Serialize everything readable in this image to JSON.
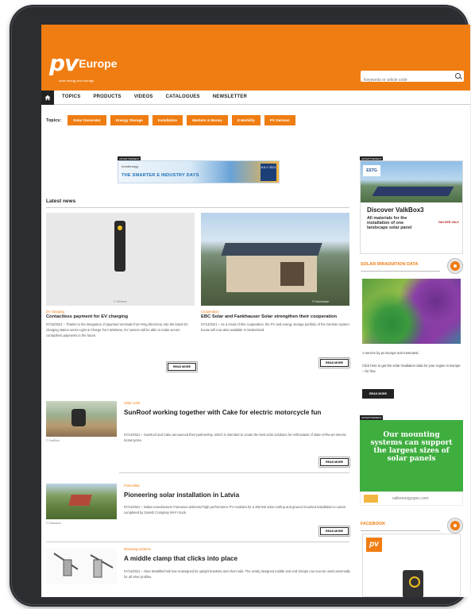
{
  "header": {
    "logo_main": "pv",
    "logo_sub": "Europe",
    "logo_tagline": "solar energy and storage",
    "search_placeholder": "Keywords or article code"
  },
  "nav": {
    "items": [
      "TOPICS",
      "PRODUCTS",
      "VIDEOS",
      "CATALOGUES",
      "NEWSLETTER"
    ]
  },
  "topics": {
    "label": "Topics:",
    "items": [
      "Solar Generator",
      "Energy Storage",
      "Installation",
      "Markets & Money",
      "E-Mobility",
      "PV German"
    ]
  },
  "banner": {
    "badge": "ADVERTISEMENT",
    "brand": "trendenergy",
    "text": "THE SMARTER E INDUSTRY DAYS",
    "date": "JULY 2021"
  },
  "latest_news": {
    "title": "Latest news",
    "cards": [
      {
        "category": "EV charging",
        "title": "Contactless payment for EV charging",
        "text": "07/15/2021 – Thanks to the integration of payment terminals from Feig Electronic into the latest EV charging station series Light & Charge from Wirelane, EV owners will be able to make secure contactless payments in the future.",
        "image_caption": "© Wirelane",
        "read_more": "READ MORE"
      },
      {
        "category": "Cooperation",
        "title": "EBC Solar and Fankhauser Solar strengthen their cooperation",
        "text": "07/14/2021 – As a result of this cooperation, the PV and energy storage portfolio of the German system house will now also available in Switzerland.",
        "image_caption": "© Fankhauser",
        "read_more": "READ MORE"
      }
    ],
    "list": [
      {
        "category": "Solar roofs",
        "title": "SunRoof working together with Cake for electric motorcycle fun",
        "text": "07/14/2021 – SunRoof and Cake announced their partnership, which is intended to create the best solar solutions for enthusiasts of state-of-the-art electric motorcycles.",
        "image_caption": "© SunRoof",
        "read_more": "READ MORE"
      },
      {
        "category": "Fotovoltaic",
        "title": "Pioneering solar installation in Latvia",
        "text": "07/14/2021 – Italian manufacturer Futurasun delivered high performance PV modules for a 282 kW solar rooftop and ground mounted installation in Latvia completed by Danish Company Wi-Fi Suck.",
        "image_caption": "© Futurasun",
        "read_more": "READ MORE"
      },
      {
        "category": "Mounting systems",
        "title": "A middle clamp that clicks into place",
        "text": "07/14/2021 – Altec Metalltechnik has redesigned its upright brackets and short rails. The newly designed middle and end clamps can now be used universally for all Altec profiles.",
        "image_caption": "",
        "read_more": "READ MORE"
      }
    ]
  },
  "sidebar": {
    "ad1": {
      "badge": "ADVERTISEMENT",
      "logo": "ESTG",
      "title": "Discover ValkBox3",
      "text": "All materials for the installation of one landscape solar panel",
      "brand": "VAN DER VALK"
    },
    "irradiation": {
      "title": "SOLAR IRRADIATION DATA",
      "caption": "A service by pv Europe and meteotest.",
      "caption2": "Click here to get the solar irradiation data for your region in Europe – for free.",
      "read_more": "READ MORE"
    },
    "ad2": {
      "badge": "ADVERTISEMENT",
      "text": "Our mounting systems can support the largest sizes of solar panels",
      "url": "valkenergyspec.com"
    },
    "facebook": {
      "title": "FACEBOOK",
      "logo": "pv"
    }
  }
}
